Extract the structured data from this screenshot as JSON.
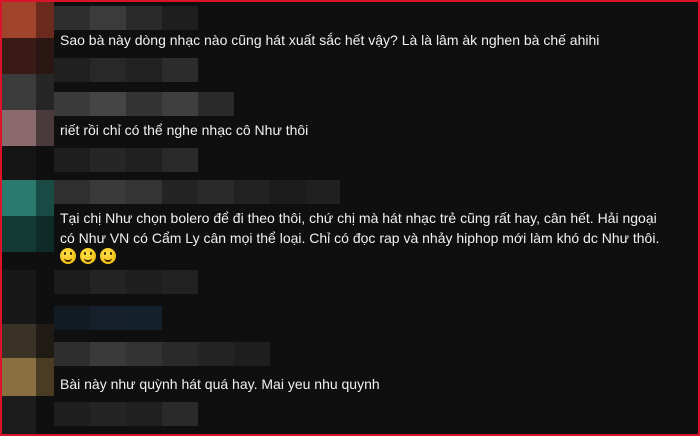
{
  "comments": [
    {
      "text": "Sao bà này dòng nhạc nào cũng hát xuất sắc hết vậy? Là là lâm àk nghen bà chế ahihi"
    },
    {
      "text": "riết rồi chỉ có thể nghe nhạc cô Như thôi"
    },
    {
      "lines": [
        "Tại chị Như chọn bolero để đi theo thôi, chứ chị mà hát nhạc trẻ cũng rất hay, cân hết. Hải ngoại",
        "có Như VN có Cẩm Ly cân mọi thể loại. Chỉ có đọc rap và nhảy hiphop mới làm khó dc Như thôi."
      ],
      "emojis": [
        "smiley-emoji",
        "smiley-emoji",
        "smiley-emoji"
      ]
    },
    {
      "text": "Bài này như quỳnh hát quá hay. Mai yeu nhu quynh"
    }
  ],
  "colors": {
    "frame": "#d8132a",
    "background": "#0f0f0f",
    "text": "#f1f1f1"
  }
}
